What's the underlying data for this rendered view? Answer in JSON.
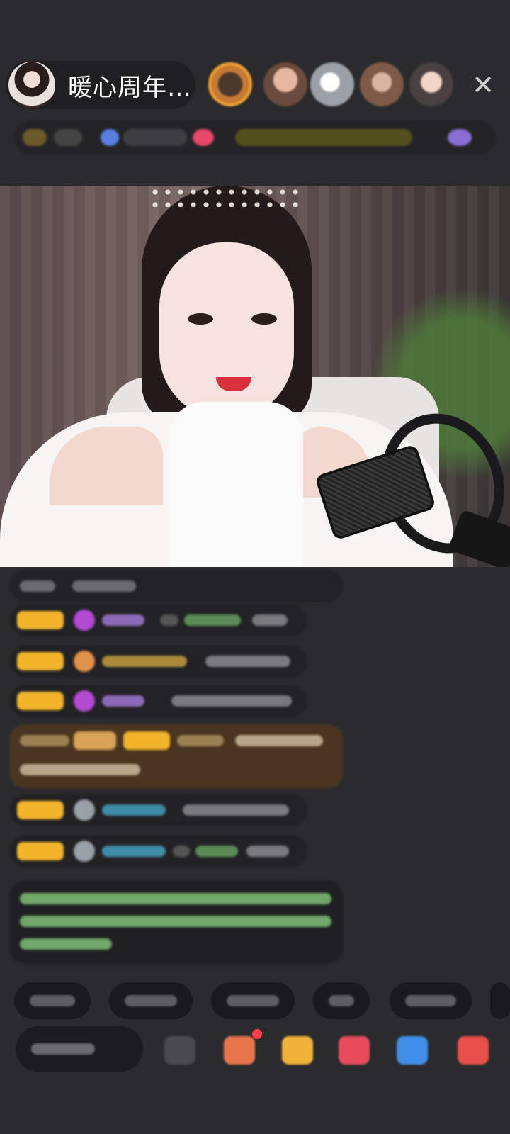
{
  "header": {
    "host_name": "暖心周年…",
    "close_icon": "close-icon"
  },
  "colors": {
    "background": "#2b2b2d",
    "badge_gold": "#f2b42a",
    "vip_purple": "#b34ad1",
    "chat_green": "#6fa86a",
    "highlight_brown": "#5a3d1c"
  }
}
